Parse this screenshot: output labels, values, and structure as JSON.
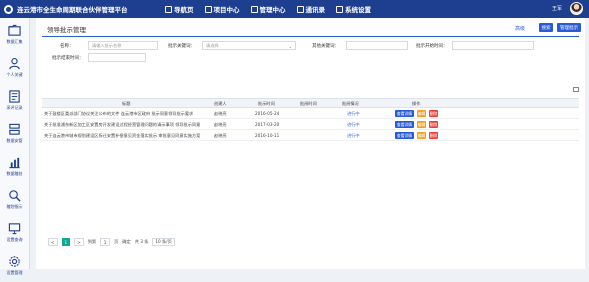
{
  "header": {
    "app_title": "连云港市全生命周期联合伙伴管理平台",
    "nav": [
      {
        "label": "导航页"
      },
      {
        "label": "项目中心"
      },
      {
        "label": "管理中心"
      },
      {
        "label": "通讯录"
      },
      {
        "label": "系统设置"
      }
    ],
    "user_name": "王军"
  },
  "sidebar": {
    "items": [
      {
        "label": "数据汇集",
        "icon": "folder-icon"
      },
      {
        "label": "个人关键",
        "icon": "user-icon"
      },
      {
        "label": "采评记录",
        "icon": "document-icon"
      },
      {
        "label": "数据安管",
        "icon": "server-icon"
      },
      {
        "label": "数据稽处",
        "icon": "chart-icon"
      },
      {
        "label": "稽划指示",
        "icon": "search-user-icon"
      },
      {
        "label": "设置查询",
        "icon": "monitor-icon"
      },
      {
        "label": "设置管理",
        "icon": "settings-icon"
      }
    ]
  },
  "page": {
    "title": "领导批示管理",
    "advanced_search": "高级",
    "search_button": "搜索",
    "manage_button": "管理批示"
  },
  "filters": {
    "title_label": "名称：",
    "title_placeholder": "请输入批示名称",
    "project_label": "批示关键词：",
    "project_value": "请选择",
    "keyword_label": "其他关键词：",
    "start_label": "批示开始时间：",
    "end_label": "批示结束时间："
  },
  "table": {
    "columns": [
      "标题",
      "创建人",
      "批示时间",
      "批阅时间",
      "批阅情况",
      "操作"
    ],
    "rows": [
      {
        "title": "关于鼓楼区委派部门协议关注公布的文件 连云港市区政府 批示同意领导批示要求",
        "creator": "赵晓亮",
        "date": "2016-05-24",
        "read_time": "",
        "status": "进行中"
      },
      {
        "title": "关于批准浦东新区加工区安置房开发建设过程经营管理问题的请示事项 领导批示同意",
        "creator": "赵晓亮",
        "date": "2017-03-20",
        "read_time": "",
        "status": "进行中"
      },
      {
        "title": "关于连云港市城市规划建设区拆迁安置补偿意见资金落实批示 审批意见同意实施方案",
        "creator": "赵晓亮",
        "date": "2016-10-11",
        "read_time": "",
        "status": "进行中"
      }
    ],
    "actions": {
      "view": "查看详情",
      "edit": "编辑",
      "delete": "删除"
    },
    "colors": {
      "view": "#2a5bd7",
      "edit": "#f0a020",
      "delete": "#e8413a"
    }
  },
  "pagination": {
    "prev": "<",
    "current": "1",
    "next": ">",
    "goto_label": "到第",
    "page_input": "1",
    "page_unit": "页",
    "confirm": "确定",
    "total": "共 3 条",
    "per_page": "10 条/页"
  }
}
